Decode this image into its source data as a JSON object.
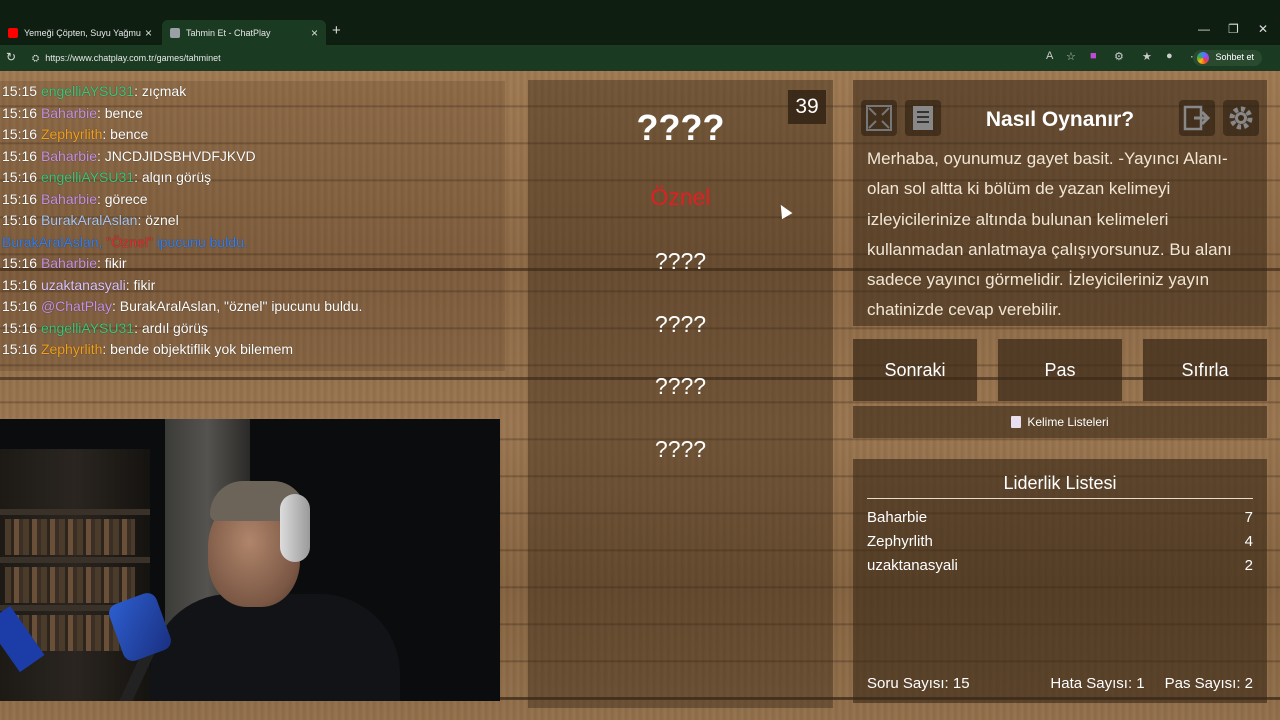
{
  "browser": {
    "tabs": [
      {
        "title": "Yemeği Çöpten, Suyu Yağmurdan...",
        "favicon_color": "#ff0000"
      },
      {
        "title": "Tahmin Et - ChatPlay",
        "favicon_color": "#9aa0a6"
      }
    ],
    "url": "https://www.chatplay.com.tr/games/tahminet",
    "sohbet_label": "Sohbet et"
  },
  "chat": {
    "lines": [
      {
        "time": "15:15",
        "user": "engelliAYSU31",
        "color": "#3ec47a",
        "text": ": zıçmak"
      },
      {
        "time": "15:16",
        "user": "Baharbie",
        "color": "#c392e3",
        "text": ": bence"
      },
      {
        "time": "15:16",
        "user": "Zephyrlith",
        "color": "#f0a020",
        "text": ": bence"
      },
      {
        "time": "15:16",
        "user": "Baharbie",
        "color": "#c392e3",
        "text": ": JNCDJIDSBHVDFJKVD"
      },
      {
        "time": "15:16",
        "user": "engelliAYSU31",
        "color": "#3ec47a",
        "text": ": alqın görüş"
      },
      {
        "time": "15:16",
        "user": "Baharbie",
        "color": "#c392e3",
        "text": ": görece"
      },
      {
        "time": "15:16",
        "user": "BurakAralAslan",
        "color": "#a7c5f0",
        "text": ": öznel"
      },
      {
        "notice_user": "BurakAralAslan, ",
        "notice_hint": "\"Öznel\"",
        "notice_rest": " ipucunu buldu."
      },
      {
        "time": "15:16",
        "user": "Baharbie",
        "color": "#c392e3",
        "text": ": fikir"
      },
      {
        "time": "15:16",
        "user": "uzaktanasyali",
        "color": "#d9c4ff",
        "text": ": fikir"
      },
      {
        "time": "15:16",
        "user": "@ChatPlay",
        "color": "#c392e3",
        "text": ": BurakAralAslan, \"öznel\" ipucunu buldu."
      },
      {
        "time": "15:16",
        "user": "engelliAYSU31",
        "color": "#3ec47a",
        "text": ": ardıl görüş"
      },
      {
        "time": "15:16",
        "user": "Zephyrlith",
        "color": "#f0a020",
        "text": ": bende objektiflik yok bilemem"
      }
    ]
  },
  "game": {
    "timer": "39",
    "main_word": "????",
    "hints": [
      "Öznel",
      "????",
      "????",
      "????",
      "????"
    ]
  },
  "howto": {
    "title": "Nasıl Oynanır?",
    "text": "Merhaba, oyunumuz gayet basit. -Yayıncı Alanı- olan sol altta ki bölüm de yazan kelimeyi izleyicilerinize altında bulunan kelimeleri kullanmadan anlatmaya çalışıyorsunuz. Bu alanı sadece yayıncı görmelidir. İzleyicileriniz yayın chatinizde cevap verebilir."
  },
  "actions": {
    "next": "Sonraki",
    "pass": "Pas",
    "reset": "Sıfırla",
    "word_lists": "Kelime Listeleri"
  },
  "leaderboard": {
    "title": "Liderlik Listesi",
    "rows": [
      {
        "name": "Baharbie",
        "score": "7"
      },
      {
        "name": "Zephyrlith",
        "score": "4"
      },
      {
        "name": "uzaktanasyali",
        "score": "2"
      }
    ],
    "question_count": "Soru Sayısı: 15",
    "error_count": "Hata Sayısı: 1",
    "pass_count": "Pas Sayısı: 2"
  }
}
